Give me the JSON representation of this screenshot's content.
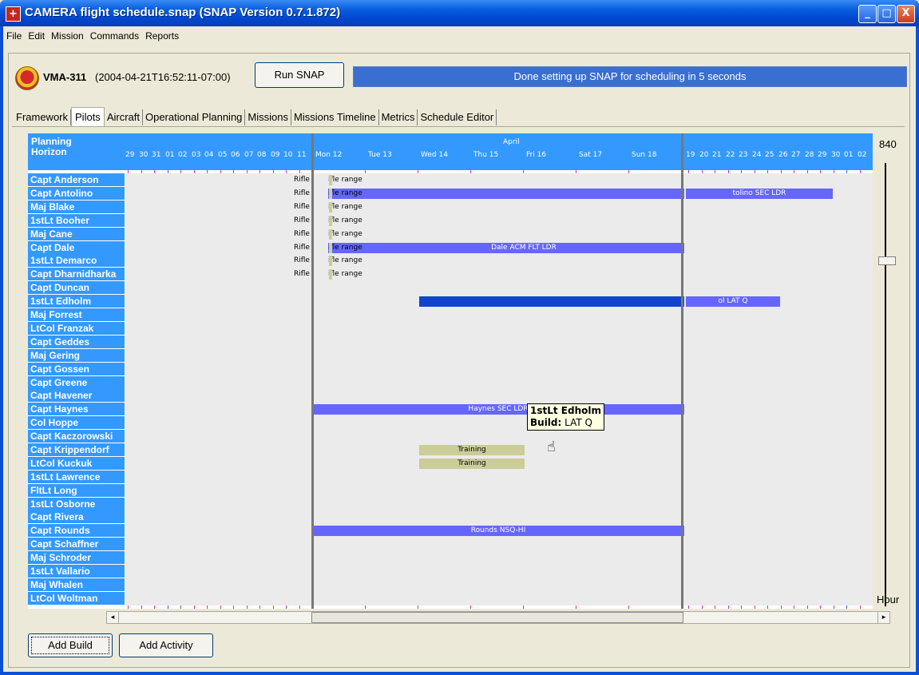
{
  "window": {
    "title": "CAMERA flight schedule.snap (SNAP Version 0.7.1.872)",
    "min": "_",
    "max": "□",
    "close": "X"
  },
  "menu": [
    "File",
    "Edit",
    "Mission",
    "Commands",
    "Reports"
  ],
  "header": {
    "squadron": "VMA-311",
    "timestamp": "(2004-04-21T16:52:11-07:00)",
    "run_button": "Run SNAP",
    "status": "Done setting up SNAP for scheduling in 5 seconds"
  },
  "tabs": [
    "Framework",
    "Pilots",
    "Aircraft",
    "Operational Planning",
    "Missions",
    "Missions Timeline",
    "Metrics",
    "Schedule Editor"
  ],
  "active_tab": "Pilots",
  "gantt": {
    "planning_label": "Planning\nHorizon",
    "month": "April",
    "left_ticks": [
      "29",
      "30",
      "31",
      "01",
      "02",
      "03",
      "04",
      "05",
      "06",
      "07",
      "08",
      "09",
      "10",
      "11"
    ],
    "week_days": [
      "Mon 12",
      "Tue 13",
      "Wed 14",
      "Thu 15",
      "Fri 16",
      "Sat 17",
      "Sun 18"
    ],
    "right_ticks": [
      "19",
      "20",
      "21",
      "22",
      "23",
      "24",
      "25",
      "26",
      "27",
      "28",
      "29",
      "30",
      "01",
      "02"
    ],
    "pilots": [
      "Capt Anderson",
      "Capt Antolino",
      "Maj Blake",
      "1stLt Booher",
      "Maj Cane",
      "Capt Dale",
      "1stLt Demarco",
      "Capt Dharnidharka",
      "Capt Duncan",
      "1stLt Edholm",
      "Maj Forrest",
      "LtCol Franzak",
      "Capt Geddes",
      "Maj Gering",
      "Capt Gossen",
      "Capt Greene",
      "Capt Havener",
      "Capt Haynes",
      "Col Hoppe",
      "Capt Kaczorowski",
      "Capt Krippendorf",
      "LtCol Kuckuk",
      "1stLt Lawrence",
      "FltLt Long",
      "1stLt Osborne",
      "Capt Rivera",
      "Capt Rounds",
      "Capt Schaffner",
      "Maj Schroder",
      "1stLt Vallario",
      "Maj Whalen",
      "LtCol Woltman"
    ],
    "rifle_text": "Rifle",
    "rifle_range_text": "ifle range",
    "bars": {
      "antolino_left": "",
      "antolino_right": "tolino SEC LDR",
      "dale": "Dale ACM FLT LDR",
      "edholm_right": "ol LAT Q",
      "haynes": "Haynes SEC LDR",
      "krippendorf": "Training",
      "kuckuk": "Training",
      "rounds": "Rounds NSQ-HI"
    },
    "tooltip": {
      "name": "1stLt Edholm",
      "build_label": "Build:",
      "build_value": "LAT Q"
    }
  },
  "zoom": {
    "value": "840",
    "unit": "Hour"
  },
  "buttons": {
    "add_build": "Add Build",
    "add_activity": "Add Activity"
  }
}
